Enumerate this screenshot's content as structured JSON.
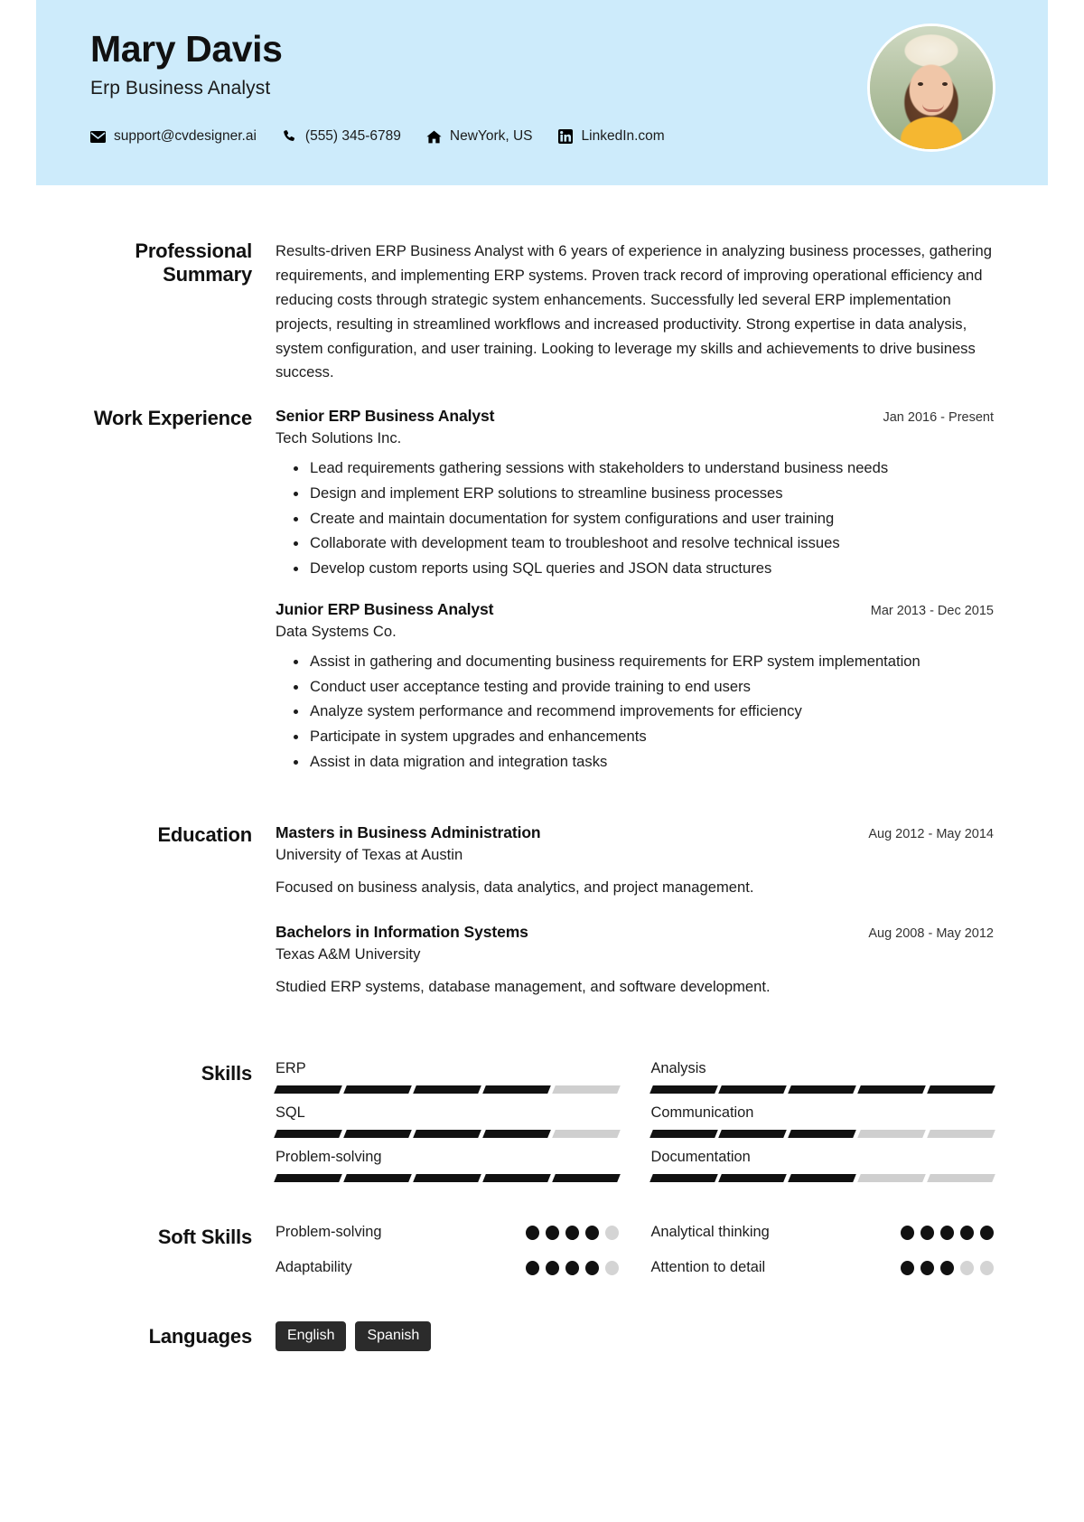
{
  "header": {
    "name": "Mary Davis",
    "job_title": "Erp Business Analyst",
    "background_color": "#cdebfb",
    "contacts": [
      {
        "icon": "envelope-icon",
        "text": "support@cvdesigner.ai"
      },
      {
        "icon": "phone-icon",
        "text": "(555) 345-6789"
      },
      {
        "icon": "home-icon",
        "text": "NewYork, US"
      },
      {
        "icon": "linkedin-icon",
        "text": "LinkedIn.com"
      }
    ],
    "avatar_alt": "Portrait photo of Mary Davis wearing a white hat"
  },
  "sections": {
    "summary": {
      "label": "Professional Summary",
      "text": "Results-driven ERP Business Analyst with 6 years of experience in analyzing business processes, gathering requirements, and implementing ERP systems. Proven track record of improving operational efficiency and reducing costs through strategic system enhancements. Successfully led several ERP implementation projects, resulting in streamlined workflows and increased productivity. Strong expertise in data analysis, system configuration, and user training. Looking to leverage my skills and achievements to drive business success."
    },
    "work": {
      "label": "Work Experience",
      "entries": [
        {
          "title": "Senior ERP Business Analyst",
          "company": "Tech Solutions Inc.",
          "date": "Jan 2016 - Present",
          "bullets": [
            "Lead requirements gathering sessions with stakeholders to understand business needs",
            "Design and implement ERP solutions to streamline business processes",
            "Create and maintain documentation for system configurations and user training",
            "Collaborate with development team to troubleshoot and resolve technical issues",
            "Develop custom reports using SQL queries and JSON data structures"
          ]
        },
        {
          "title": "Junior ERP Business Analyst",
          "company": "Data Systems Co.",
          "date": "Mar 2013 - Dec 2015",
          "bullets": [
            "Assist in gathering and documenting business requirements for ERP system implementation",
            "Conduct user acceptance testing and provide training to end users",
            "Analyze system performance and recommend improvements for efficiency",
            "Participate in system upgrades and enhancements",
            "Assist in data migration and integration tasks"
          ]
        }
      ]
    },
    "education": {
      "label": "Education",
      "entries": [
        {
          "degree": "Masters in Business Administration",
          "school": "University of Texas at Austin",
          "date": "Aug 2012 - May 2014",
          "description": "Focused on business analysis, data analytics, and project management."
        },
        {
          "degree": "Bachelors in Information Systems",
          "school": "Texas A&M University",
          "date": "Aug 2008 - May 2012",
          "description": "Studied ERP systems, database management, and software development."
        }
      ]
    },
    "skills": {
      "label": "Skills",
      "max_level": 5,
      "items": [
        {
          "name": "ERP",
          "level": 4
        },
        {
          "name": "Analysis",
          "level": 5
        },
        {
          "name": "SQL",
          "level": 4
        },
        {
          "name": "Communication",
          "level": 3
        },
        {
          "name": "Problem-solving",
          "level": 5
        },
        {
          "name": "Documentation",
          "level": 3
        }
      ]
    },
    "soft_skills": {
      "label": "Soft Skills",
      "max_level": 5,
      "items": [
        {
          "name": "Problem-solving",
          "level": 4
        },
        {
          "name": "Analytical thinking",
          "level": 5
        },
        {
          "name": "Adaptability",
          "level": 4
        },
        {
          "name": "Attention to detail",
          "level": 3
        }
      ]
    },
    "languages": {
      "label": "Languages",
      "items": [
        "English",
        "Spanish"
      ]
    }
  }
}
